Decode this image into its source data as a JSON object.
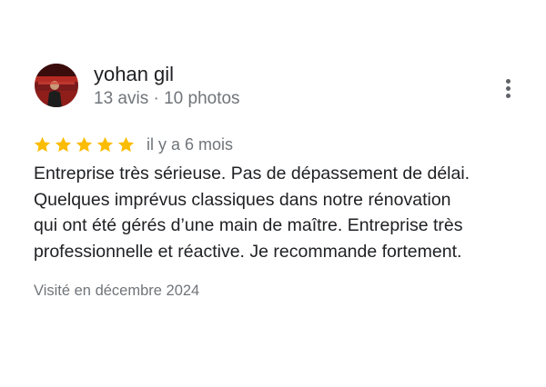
{
  "review": {
    "author": {
      "name": "yohan gil",
      "meta": "13 avis · 10 photos",
      "avatar_icon": "user-photo-icon"
    },
    "more_icon": "more-vert-icon",
    "rating": {
      "value": 5,
      "max": 5,
      "star_color": "#fbbc04",
      "date": "il y a 6 mois"
    },
    "text_lines": [
      "Entreprise très sérieuse. Pas de dépassement de délai.",
      "Quelques imprévus classiques dans notre rénovation",
      "qui ont été gérés d’une main de maître. Entreprise très",
      "professionnelle et réactive. Je recommande fortement."
    ],
    "visit_date": "Visité en décembre 2024"
  }
}
